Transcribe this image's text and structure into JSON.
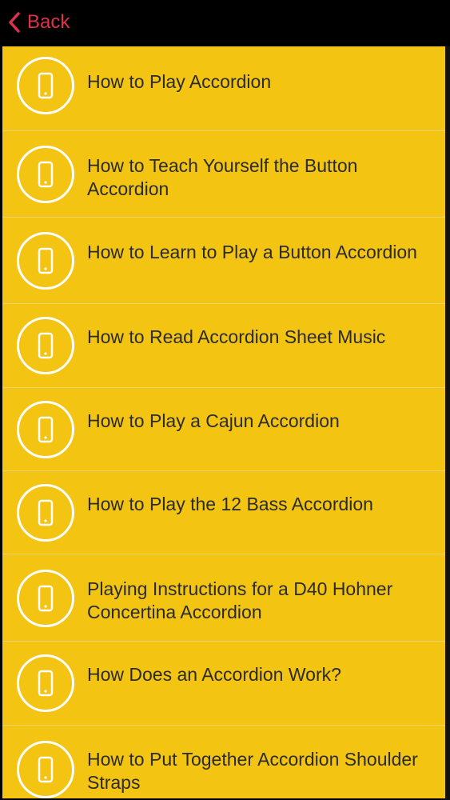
{
  "nav": {
    "back_label": "Back",
    "accent_color": "#e0304a"
  },
  "list": {
    "background_color": "#f3c412",
    "icon": "phone-icon",
    "items": [
      {
        "label": "How to Play Accordion"
      },
      {
        "label": "How to Teach Yourself the Button Accordion"
      },
      {
        "label": "How to Learn to Play a Button Accordion"
      },
      {
        "label": "How to Read Accordion Sheet Music"
      },
      {
        "label": "How to Play a Cajun Accordion"
      },
      {
        "label": "How to Play the 12 Bass Accordion"
      },
      {
        "label": "Playing Instructions for a D40 Hohner Concertina Accordion"
      },
      {
        "label": "How Does an Accordion Work?"
      },
      {
        "label": "How to Put Together Accordion Shoulder Straps"
      }
    ]
  }
}
